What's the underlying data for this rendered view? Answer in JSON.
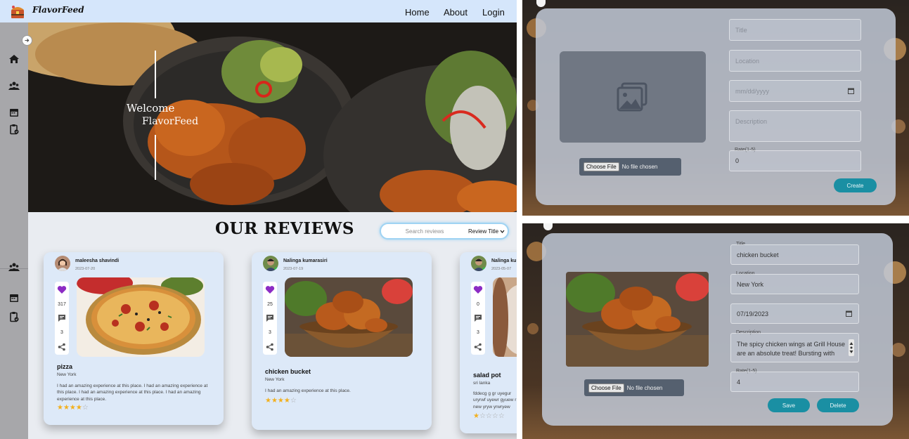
{
  "navbar": {
    "brand": "FlavorFeed",
    "links": [
      "Home",
      "About",
      "Login"
    ]
  },
  "sidebar": {
    "icons": [
      "home-icon",
      "users-icon",
      "calendar-icon",
      "clipboard-icon",
      "users-icon",
      "calendar-icon",
      "clipboard-icon"
    ]
  },
  "hero": {
    "line1": "Welcome",
    "line2": "FlavorFeed"
  },
  "reviews": {
    "heading": "OUR REVIEWS",
    "search_placeholder": "Search reviews",
    "sort_selected": "Review Title",
    "cards": [
      {
        "author": "maleesha shavindi",
        "date": "2023-07-20",
        "likes": "317",
        "comments": "3",
        "title": "pizza",
        "location": "New York",
        "description": "I had an amazing experience at this place. I had an amazing experience at this place. I had an amazing experience at this place. I had an amazing experience at this place.",
        "rating": 4
      },
      {
        "author": "Nalinga kumarasiri",
        "date": "2023-07-19",
        "likes": "25",
        "comments": "3",
        "title": "chicken bucket",
        "location": "New York",
        "description": "I had an amazing experience at this place.",
        "rating": 4
      },
      {
        "author": "Nalinga ku",
        "date": "2023-05-07",
        "likes": "0",
        "comments": "3",
        "title": "salad pot",
        "location": "sri lanka",
        "description": "fddecg g gr uyegur uryrwf uyewr gyuew r new yryw yrwryew",
        "rating": 1
      }
    ]
  },
  "create_form": {
    "title_placeholder": "Title",
    "location_placeholder": "Location",
    "date_placeholder": "mm/dd/yyyy",
    "description_placeholder": "Description",
    "rate_label": "Rate(1-5)",
    "rate_value": "0",
    "file_button": "Choose File",
    "file_status": "No file chosen",
    "submit_label": "Create"
  },
  "edit_form": {
    "title_label": "Title",
    "title_value": "chicken bucket",
    "location_label": "Location",
    "location_value": "New York",
    "date_value": "07/19/2023",
    "description_label": "Description",
    "description_value": "The spicy chicken wings at Grill House are an absolute treat! Bursting with",
    "rate_label": "Rate(1-5)",
    "rate_value": "4",
    "file_button": "Choose File",
    "file_status": "No file chosen",
    "save_label": "Save",
    "delete_label": "Delete"
  },
  "colors": {
    "navbar_bg": "#d5e6fb",
    "sidebar_bg": "#a7a7aa",
    "card_bg": "#dde9f8",
    "like_heart": "#8c2bc4",
    "star": "#f2b01e",
    "button_teal": "#1a8fa3"
  }
}
